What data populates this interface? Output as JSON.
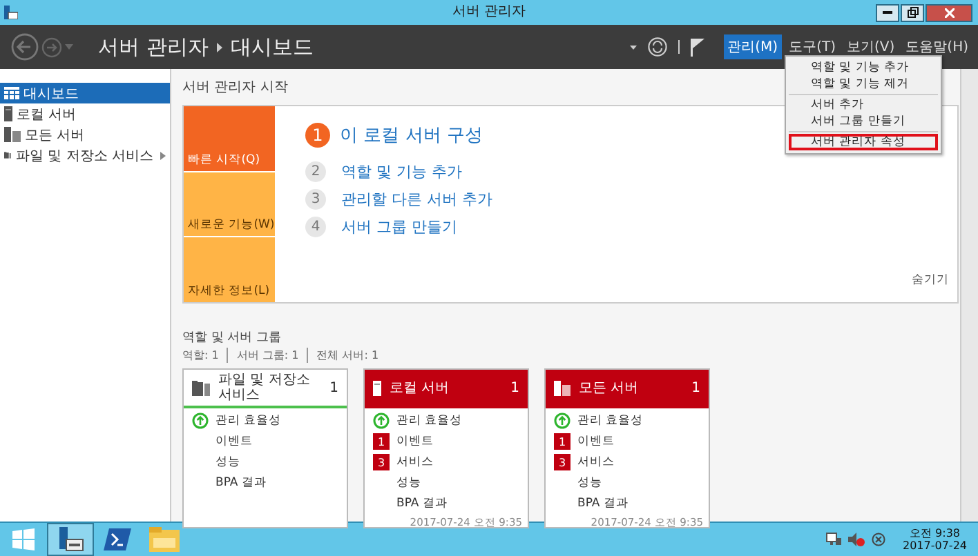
{
  "window": {
    "title": "서버 관리자"
  },
  "header": {
    "app": "서버 관리자",
    "page": "대시보드"
  },
  "menu": [
    {
      "label": "관리(M)",
      "selected": true
    },
    {
      "label": "도구(T)",
      "selected": false
    },
    {
      "label": "보기(V)",
      "selected": false
    },
    {
      "label": "도움말(H)",
      "selected": false
    }
  ],
  "dropdown": {
    "groups": [
      {
        "items": [
          {
            "label": "역할 및 기능 추가",
            "marked": false
          },
          {
            "label": "역할 및 기능 제거",
            "marked": false
          }
        ]
      },
      {
        "items": [
          {
            "label": "서버 추가",
            "marked": false
          },
          {
            "label": "서버 그룹 만들기",
            "marked": false
          }
        ]
      },
      {
        "items": [
          {
            "label": "서버 관리자 속성",
            "marked": true
          }
        ]
      }
    ]
  },
  "sidebar": [
    {
      "label": "대시보드",
      "kind": "dashboard",
      "selected": true,
      "expandable": false
    },
    {
      "label": "로컬 서버",
      "kind": "server",
      "selected": false,
      "expandable": false
    },
    {
      "label": "모든 서버",
      "kind": "servers",
      "selected": false,
      "expandable": false
    },
    {
      "label": "파일 및 저장소 서비스",
      "kind": "storage",
      "selected": false,
      "expandable": true
    }
  ],
  "main": {
    "heading": "서버 관리자 시작",
    "quick_start": {
      "tabs": [
        {
          "label": "빠른 시작(Q)",
          "selected": true
        },
        {
          "label": "새로운 기능(W)",
          "selected": false
        },
        {
          "label": "자세한 정보(L)",
          "selected": false
        }
      ],
      "steps": [
        {
          "number": "1",
          "label": "이 로컬 서버 구성",
          "primary": true
        },
        {
          "number": "2",
          "label": "역할 및 기능 추가",
          "primary": false
        },
        {
          "number": "3",
          "label": "관리할 다른 서버 추가",
          "primary": false
        },
        {
          "number": "4",
          "label": "서버 그룹 만들기",
          "primary": false
        }
      ],
      "hide": "숨기기"
    },
    "roles": {
      "title": "역할 및 서버 그룹",
      "summary": [
        "역할: 1",
        "서버 그룹: 1",
        "전체 서버: 1"
      ],
      "cards": [
        {
          "title": "파일 및 저장소 서비스",
          "kind": "storage",
          "count": "1",
          "alert": false,
          "rows": [
            {
              "label": "관리 효율성",
              "kind": "status"
            },
            {
              "label": "이벤트",
              "kind": "plain"
            },
            {
              "label": "성능",
              "kind": "plain"
            },
            {
              "label": "BPA 결과",
              "kind": "plain"
            }
          ]
        },
        {
          "title": "로컬 서버",
          "kind": "server",
          "count": "1",
          "alert": true,
          "rows": [
            {
              "label": "관리 효율성",
              "kind": "status"
            },
            {
              "label": "이벤트",
              "kind": "badge",
              "badge": "1"
            },
            {
              "label": "서비스",
              "kind": "badge",
              "badge": "3"
            },
            {
              "label": "성능",
              "kind": "plain"
            },
            {
              "label": "BPA 결과",
              "kind": "plain"
            }
          ],
          "timestamp": "2017-07-24 오전 9:35"
        },
        {
          "title": "모든 서버",
          "kind": "servers",
          "count": "1",
          "alert": true,
          "rows": [
            {
              "label": "관리 효율성",
              "kind": "status"
            },
            {
              "label": "이벤트",
              "kind": "badge",
              "badge": "1"
            },
            {
              "label": "서비스",
              "kind": "badge",
              "badge": "3"
            },
            {
              "label": "성능",
              "kind": "plain"
            },
            {
              "label": "BPA 결과",
              "kind": "plain"
            }
          ],
          "timestamp": "2017-07-24 오전 9:35"
        }
      ]
    }
  },
  "taskbar": {
    "apps": [
      {
        "kind": "start",
        "selected": false
      },
      {
        "kind": "server-manager",
        "selected": true
      },
      {
        "kind": "powershell",
        "selected": false
      },
      {
        "kind": "explorer",
        "selected": false
      }
    ],
    "time": "오전 9:38",
    "date": "2017-07-24"
  }
}
